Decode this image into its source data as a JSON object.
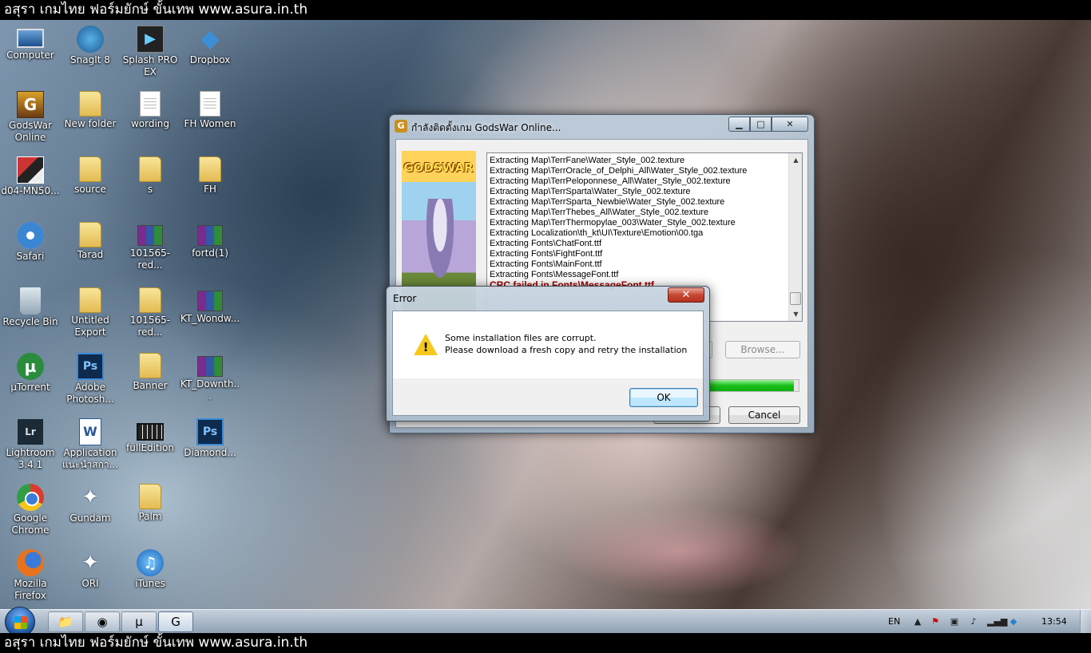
{
  "banner_text": "อสุรา เกมไทย ฟอร์มยักษ์ ขั้นเทพ www.asura.in.th",
  "desktop_icons": [
    {
      "label": "Computer",
      "icon": "computer-icon"
    },
    {
      "label": "SnagIt 8",
      "icon": "snagit-icon"
    },
    {
      "label": "Splash PRO EX",
      "icon": "splash-icon"
    },
    {
      "label": "Dropbox",
      "icon": "dropbox-icon"
    },
    {
      "label": "GodsWar Online",
      "icon": "godswar-icon"
    },
    {
      "label": "New folder",
      "icon": "folder-icon"
    },
    {
      "label": "wording",
      "icon": "document-icon"
    },
    {
      "label": "FH Women",
      "icon": "document-icon"
    },
    {
      "label": "d04-MN50...",
      "icon": "image-icon"
    },
    {
      "label": "source",
      "icon": "folder-icon"
    },
    {
      "label": "s",
      "icon": "folder-icon"
    },
    {
      "label": "FH",
      "icon": "folder-icon"
    },
    {
      "label": "Safari",
      "icon": "safari-icon"
    },
    {
      "label": "Tarad",
      "icon": "folder-icon"
    },
    {
      "label": "101565-red...",
      "icon": "winrar-icon"
    },
    {
      "label": "fortd(1)",
      "icon": "winrar-icon"
    },
    {
      "label": "Recycle Bin",
      "icon": "recycle-bin-icon"
    },
    {
      "label": "Untitled Export",
      "icon": "folder-icon"
    },
    {
      "label": "101565-red...",
      "icon": "folder-icon"
    },
    {
      "label": "KT_Wondw...",
      "icon": "winrar-icon"
    },
    {
      "label": "µTorrent",
      "icon": "utorrent-icon"
    },
    {
      "label": "Adobe Photosh...",
      "icon": "photoshop-icon"
    },
    {
      "label": "Banner",
      "icon": "folder-icon"
    },
    {
      "label": "KT_Downth...",
      "icon": "winrar-icon"
    },
    {
      "label": "Lightroom 3.4.1",
      "icon": "lightroom-icon"
    },
    {
      "label": "Application แนะนำสกา...",
      "icon": "word-document-icon"
    },
    {
      "label": "fullEdition",
      "icon": "video-icon"
    },
    {
      "label": "Diamond...",
      "icon": "psd-file-icon"
    },
    {
      "label": "Google Chrome",
      "icon": "chrome-icon"
    },
    {
      "label": "Gundam",
      "icon": "gundam-icon"
    },
    {
      "label": "Palm",
      "icon": "folder-icon"
    },
    {
      "label": "",
      "icon": ""
    },
    {
      "label": "Mozilla Firefox",
      "icon": "firefox-icon"
    },
    {
      "label": "ORI",
      "icon": "gundam-icon"
    },
    {
      "label": "iTunes",
      "icon": "itunes-icon"
    }
  ],
  "installer": {
    "title": "กำลังติดตั้งเกม GodsWar Online...",
    "banner_logo": "GODSWAR",
    "log_lines": [
      "Extracting Map\\TerrFane\\Water_Style_002.texture",
      "Extracting Map\\TerrOracle_of_Delphi_All\\Water_Style_002.texture",
      "Extracting Map\\TerrPeloponnese_All\\Water_Style_002.texture",
      "Extracting Map\\TerrSparta\\Water_Style_002.texture",
      "Extracting Map\\TerrSparta_Newbie\\Water_Style_002.texture",
      "Extracting Map\\TerrThebes_All\\Water_Style_002.texture",
      "Extracting Map\\TerrThermopylae_003\\Water_Style_002.texture",
      "Extracting Localization\\th_kt\\UI\\Texture\\Emotion\\00.tga",
      "Extracting Fonts\\ChatFont.ttf",
      "Extracting Fonts\\FightFont.ttf",
      "Extracting Fonts\\MainFont.ttf",
      "Extracting Fonts\\MessageFont.ttf"
    ],
    "error_line": "CRC failed in Fonts\\MessageFont.ttf",
    "browse_label": "Browse...",
    "cancel_label": "Cancel",
    "progress": 0.95,
    "minimize_glyph": "▁",
    "maximize_glyph": "□",
    "close_glyph": "✕"
  },
  "error_dialog": {
    "title": "Error",
    "message_line1": "Some installation files are corrupt.",
    "message_line2": "Please download a fresh copy and retry the installation",
    "ok_label": "OK",
    "close_glyph": "✕"
  },
  "taskbar": {
    "pinned": [
      {
        "icon": "explorer-icon",
        "glyph": "📁"
      },
      {
        "icon": "chrome-icon",
        "glyph": "◉"
      },
      {
        "icon": "utorrent-icon",
        "glyph": "µ"
      },
      {
        "icon": "godswar-installer-icon",
        "glyph": "G"
      }
    ],
    "language": "EN",
    "clock": "13:54"
  }
}
